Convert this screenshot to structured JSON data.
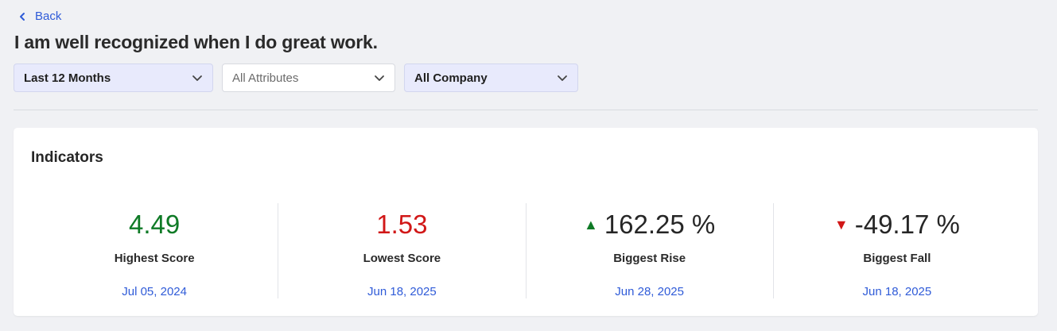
{
  "nav": {
    "back_label": "Back"
  },
  "page": {
    "title": "I am well recognized when I do great work."
  },
  "filters": {
    "period": "Last 12 Months",
    "attributes_placeholder": "All Attributes",
    "scope": "All Company"
  },
  "indicators": {
    "title": "Indicators",
    "metrics": [
      {
        "value": "4.49",
        "label": "Highest Score",
        "date": "Jul 05, 2024"
      },
      {
        "value": "1.53",
        "label": "Lowest Score",
        "date": "Jun 18, 2025"
      },
      {
        "value": "162.25 %",
        "label": "Biggest Rise",
        "date": "Jun 28, 2025",
        "trend": "up"
      },
      {
        "value": "-49.17 %",
        "label": "Biggest Fall",
        "date": "Jun 18, 2025",
        "trend": "down"
      }
    ]
  },
  "colors": {
    "accent": "#2f5bd8",
    "positive": "#0f7a26",
    "negative": "#d11717"
  }
}
